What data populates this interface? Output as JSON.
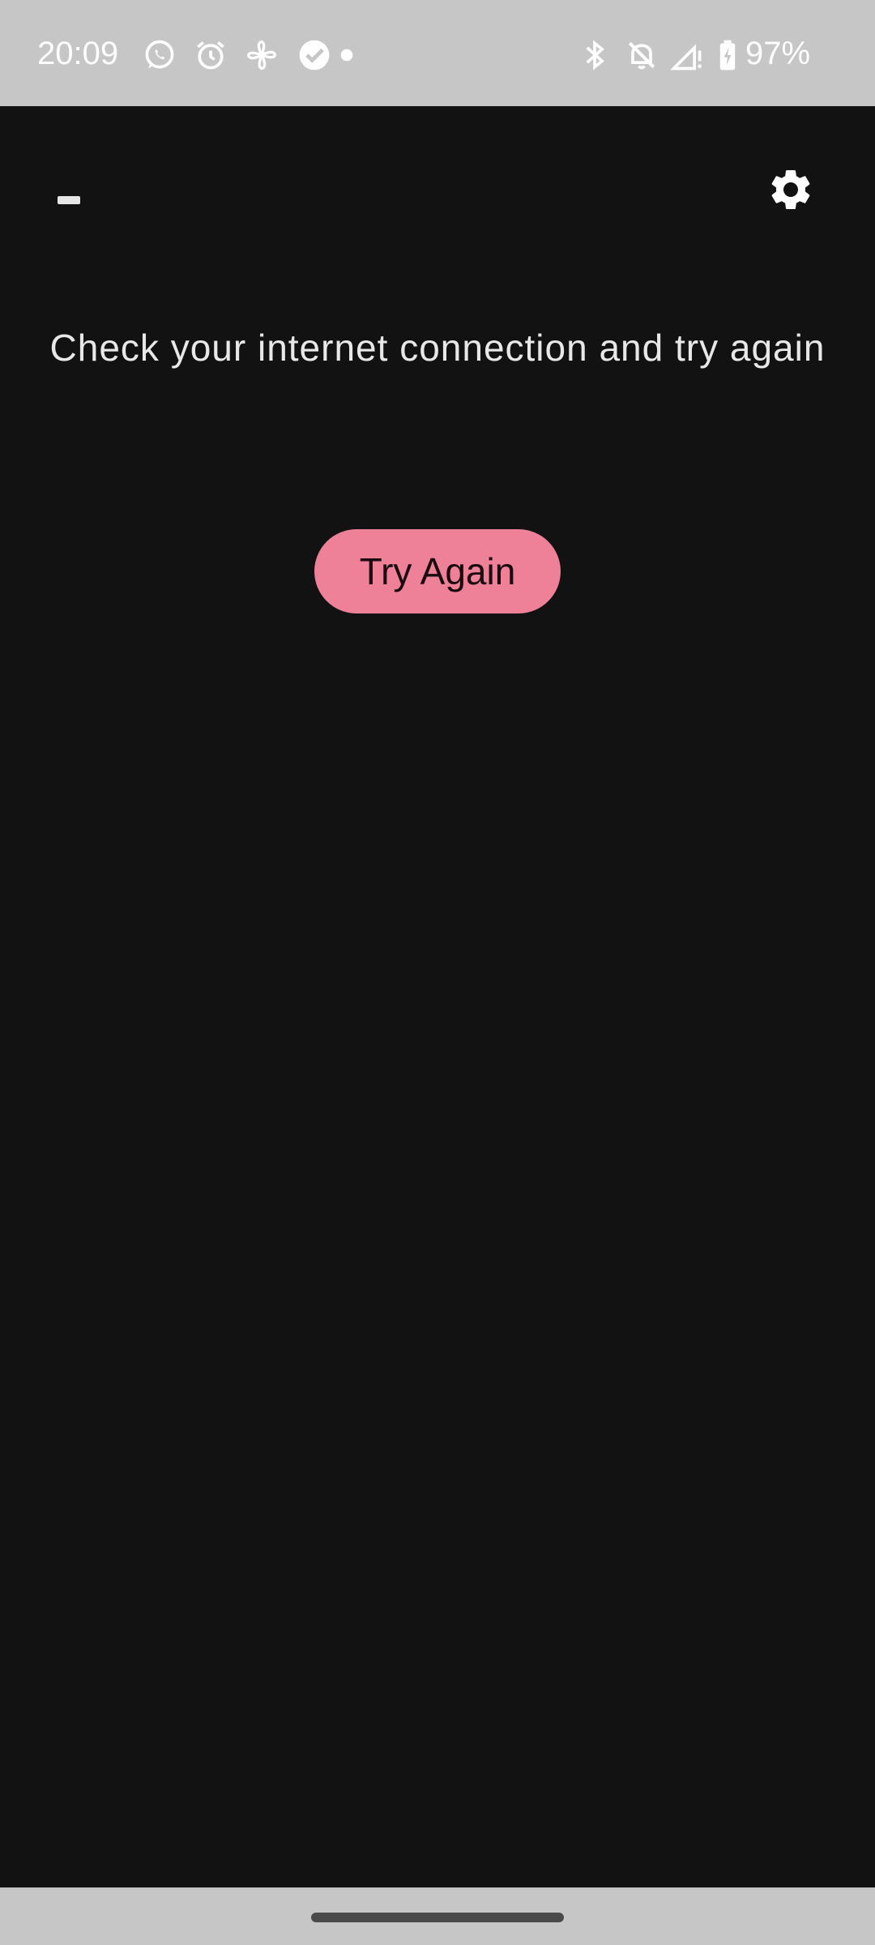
{
  "status_bar": {
    "time": "20:09",
    "left_icons": [
      "whatsapp-icon",
      "alarm-icon",
      "pinwheel-icon",
      "checkmark-badge-icon",
      "dot-icon"
    ],
    "right_icons": [
      "bluetooth-icon",
      "bell-off-icon",
      "signal-icon",
      "battery-charging-icon"
    ],
    "battery_percent": "97%",
    "background": "#c6c6c6"
  },
  "app": {
    "background": "#121212",
    "error_message": "Check your internet connection and try again",
    "retry_button_label": "Try Again",
    "retry_button_color": "#ee8098",
    "top_left_icon": "minus-icon",
    "top_right_icon": "gear-icon"
  },
  "nav_bar": {
    "handle": "home-handle"
  }
}
